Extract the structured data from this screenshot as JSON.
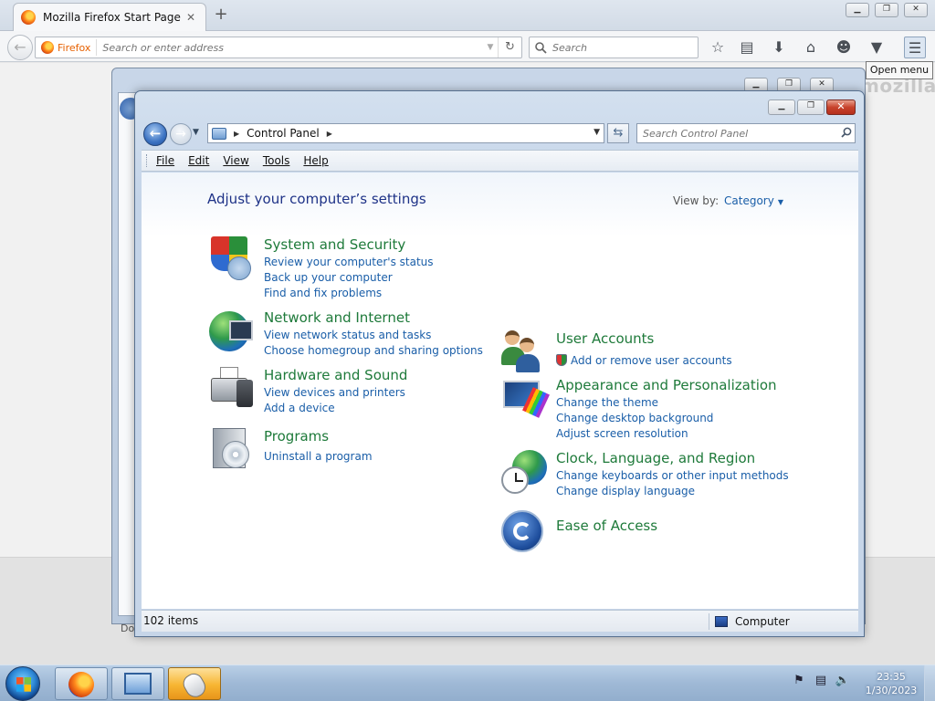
{
  "firefox": {
    "tab_title": "Mozilla Firefox Start Page",
    "tab_close": "✕",
    "new_tab": "+",
    "identity_label": "Firefox",
    "url_placeholder": "Search or enter address",
    "search_placeholder": "Search",
    "tooltip": "Open menu",
    "brand_text": "mozilla",
    "bottom_text": "Do",
    "window_controls": {
      "minimize": "▁",
      "maximize": "❐",
      "close": "✕"
    }
  },
  "control_panel": {
    "window_controls": {
      "minimize": "▁",
      "maximize": "❐",
      "close": "✕"
    },
    "breadcrumb": "Control Panel",
    "search_placeholder": "Search Control Panel",
    "menu": [
      "File",
      "Edit",
      "View",
      "Tools",
      "Help"
    ],
    "heading": "Adjust your computer’s settings",
    "view_by_label": "View by:",
    "view_by_value": "Category",
    "categories": [
      {
        "title": "System and Security",
        "icon": "shield-icon",
        "links": [
          "Review your computer's status",
          "Back up your computer",
          "Find and fix problems"
        ]
      },
      {
        "title": "Network and Internet",
        "icon": "network-globe-icon",
        "links": [
          "View network status and tasks",
          "Choose homegroup and sharing options"
        ]
      },
      {
        "title": "Hardware and Sound",
        "icon": "printer-icon",
        "links": [
          "View devices and printers",
          "Add a device"
        ]
      },
      {
        "title": "Programs",
        "icon": "programs-icon",
        "links": [
          "Uninstall a program"
        ]
      },
      {
        "title": "User Accounts",
        "icon": "users-icon",
        "links": [
          "Add or remove user accounts"
        ]
      },
      {
        "title": "Appearance and Personalization",
        "icon": "appearance-icon",
        "links": [
          "Change the theme",
          "Change desktop background",
          "Adjust screen resolution"
        ]
      },
      {
        "title": "Clock, Language, and Region",
        "icon": "clock-globe-icon",
        "links": [
          "Change keyboards or other input methods",
          "Change display language"
        ]
      },
      {
        "title": "Ease of Access",
        "icon": "ease-of-access-icon",
        "links": []
      }
    ],
    "status_count": "102 items",
    "status_zone": "Computer"
  },
  "taskbar": {
    "time": "23:35",
    "date": "1/30/2023"
  },
  "colors": {
    "link": "#1a5ea8",
    "category_title": "#1e7a3a",
    "heading": "#1e3287"
  }
}
